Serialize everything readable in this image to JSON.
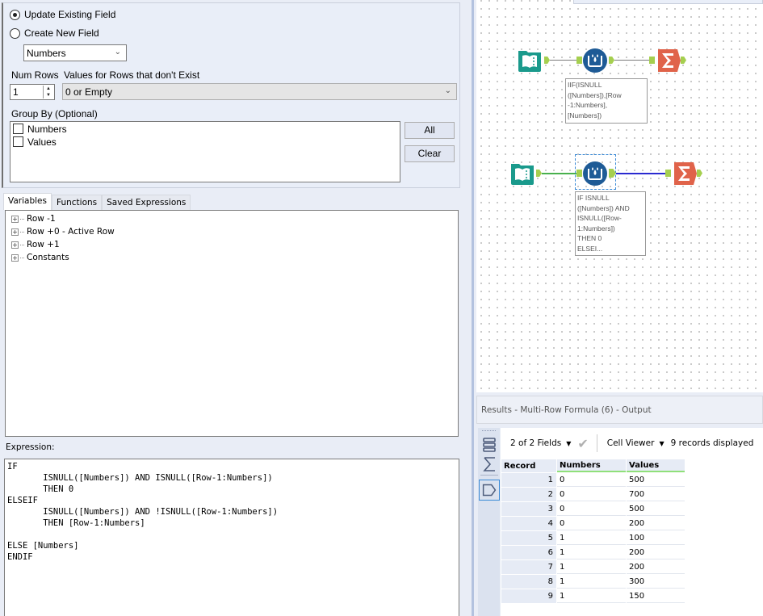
{
  "config": {
    "radio_update": "Update Existing Field",
    "radio_create": "Create New  Field",
    "radio_selected": "update",
    "field_select": "Numbers",
    "num_rows_label": "Num Rows",
    "num_rows_value": "1",
    "values_label": "Values for Rows that don't Exist",
    "values_select": "0 or Empty",
    "group_by_label": "Group By (Optional)",
    "group_by_items": [
      {
        "label": "Numbers",
        "checked": false
      },
      {
        "label": "Values",
        "checked": false
      }
    ],
    "all_button": "All",
    "clear_button": "Clear"
  },
  "tabs": [
    {
      "label": "Variables",
      "active": true
    },
    {
      "label": "Functions",
      "active": false
    },
    {
      "label": "Saved Expressions",
      "active": false
    }
  ],
  "variables_tree": [
    {
      "label": "Row -1"
    },
    {
      "label": "Row +0 - Active Row"
    },
    {
      "label": "Row +1"
    },
    {
      "label": "Constants"
    }
  ],
  "expression": {
    "label": "Expression:",
    "text": "IF\n       ISNULL([Numbers]) AND ISNULL([Row-1:Numbers])\n       THEN 0\nELSEIF\n       ISNULL([Numbers]) AND !ISNULL([Row-1:Numbers])\n       THEN [Row-1:Numbers]\n\nELSE [Numbers]\nENDIF"
  },
  "canvas": {
    "workflows": [
      {
        "tools": [
          "input-data-icon",
          "multi-row-formula-icon",
          "summarize-icon"
        ],
        "annotation": "IIF(ISNULL\n([Numbers]),[Row\n-1:Numbers],\n[Numbers])"
      },
      {
        "tools": [
          "input-data-icon",
          "multi-row-formula-icon",
          "summarize-icon"
        ],
        "annotation": "IF ISNULL\n([Numbers]) AND\nISNULL([Row-\n1:Numbers])\nTHEN 0\nELSEI...",
        "selected": true
      }
    ],
    "colors": {
      "input": "#1a9a8c",
      "formula": "#1e5b96",
      "summarize": "#e0634a",
      "anchor": "#a5cf4f",
      "conn_green": "#48b04c",
      "conn_blue": "#2a2ad0"
    }
  },
  "results": {
    "title": "Results - Multi-Row Formula (6) - Output",
    "fields_dropdown": "2 of 2 Fields",
    "cell_viewer": "Cell Viewer",
    "records_info": "9 records displayed",
    "columns": [
      "Record",
      "Numbers",
      "Values"
    ],
    "rows": [
      [
        "1",
        "0",
        "500"
      ],
      [
        "2",
        "0",
        "700"
      ],
      [
        "3",
        "0",
        "500"
      ],
      [
        "4",
        "0",
        "200"
      ],
      [
        "5",
        "1",
        "100"
      ],
      [
        "6",
        "1",
        "200"
      ],
      [
        "7",
        "1",
        "200"
      ],
      [
        "8",
        "1",
        "300"
      ],
      [
        "9",
        "1",
        "150"
      ]
    ]
  }
}
